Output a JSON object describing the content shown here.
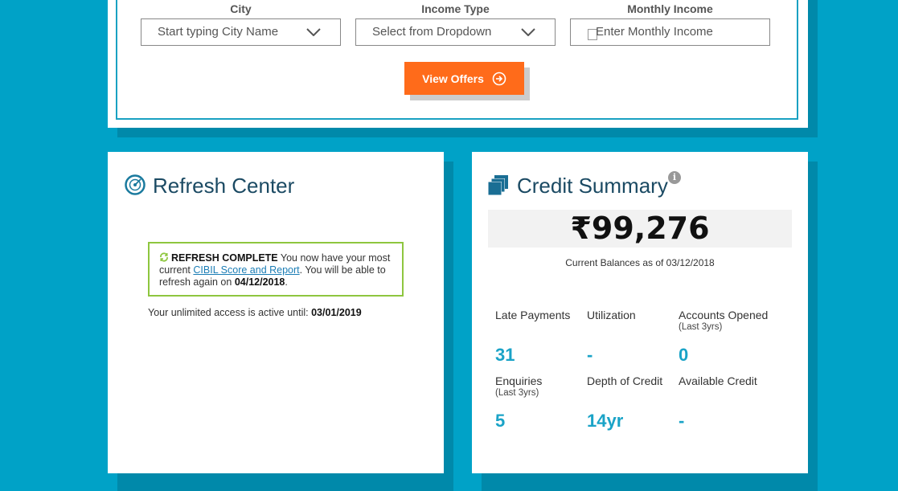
{
  "offer_form": {
    "city": {
      "label": "City",
      "placeholder": "Start typing City Name"
    },
    "income_type": {
      "label": "Income Type",
      "placeholder": "Select from Dropdown"
    },
    "monthly_income": {
      "label": "Monthly Income",
      "placeholder": "Enter Monthly Income"
    },
    "view_offers_label": "View Offers"
  },
  "refresh_center": {
    "title": "Refresh Center",
    "status_heading": "REFRESH COMPLETE",
    "status_text_1": " You now have your most current ",
    "report_link": "CIBIL Score and Report",
    "status_text_2": ". You will be able to refresh again on ",
    "refresh_date": "04/12/2018",
    "status_text_3": ".",
    "access_text": "Your unlimited access is active until: ",
    "access_date": "03/01/2019"
  },
  "credit_summary": {
    "title": "Credit Summary",
    "info_icon": "i",
    "balance": "₹99,276",
    "balance_caption": "Current Balances as of 03/12/2018",
    "stats": [
      {
        "label": "Late Payments",
        "sub": "",
        "value": "31"
      },
      {
        "label": "Utilization",
        "sub": "",
        "value": "-"
      },
      {
        "label": "Accounts Opened",
        "sub": "(Last 3yrs)",
        "value": "0"
      },
      {
        "label": "Enquiries",
        "sub": "(Last 3yrs)",
        "value": "5"
      },
      {
        "label": "Depth of Credit",
        "sub": "",
        "value": "14yr"
      },
      {
        "label": "Available Credit",
        "sub": "",
        "value": "-"
      }
    ]
  },
  "colors": {
    "background": "#00a2c7",
    "accent_orange": "#ff6b1a",
    "value_blue": "#1aa3c7",
    "success_green": "#8ec63f"
  },
  "icons": {
    "dropdown": "chevron-down-icon",
    "view_offers": "arrow-circle-right-icon",
    "refresh_center": "radar-icon",
    "refresh_status": "sync-icon",
    "credit_summary": "stacked-cards-icon",
    "info": "info-icon"
  }
}
